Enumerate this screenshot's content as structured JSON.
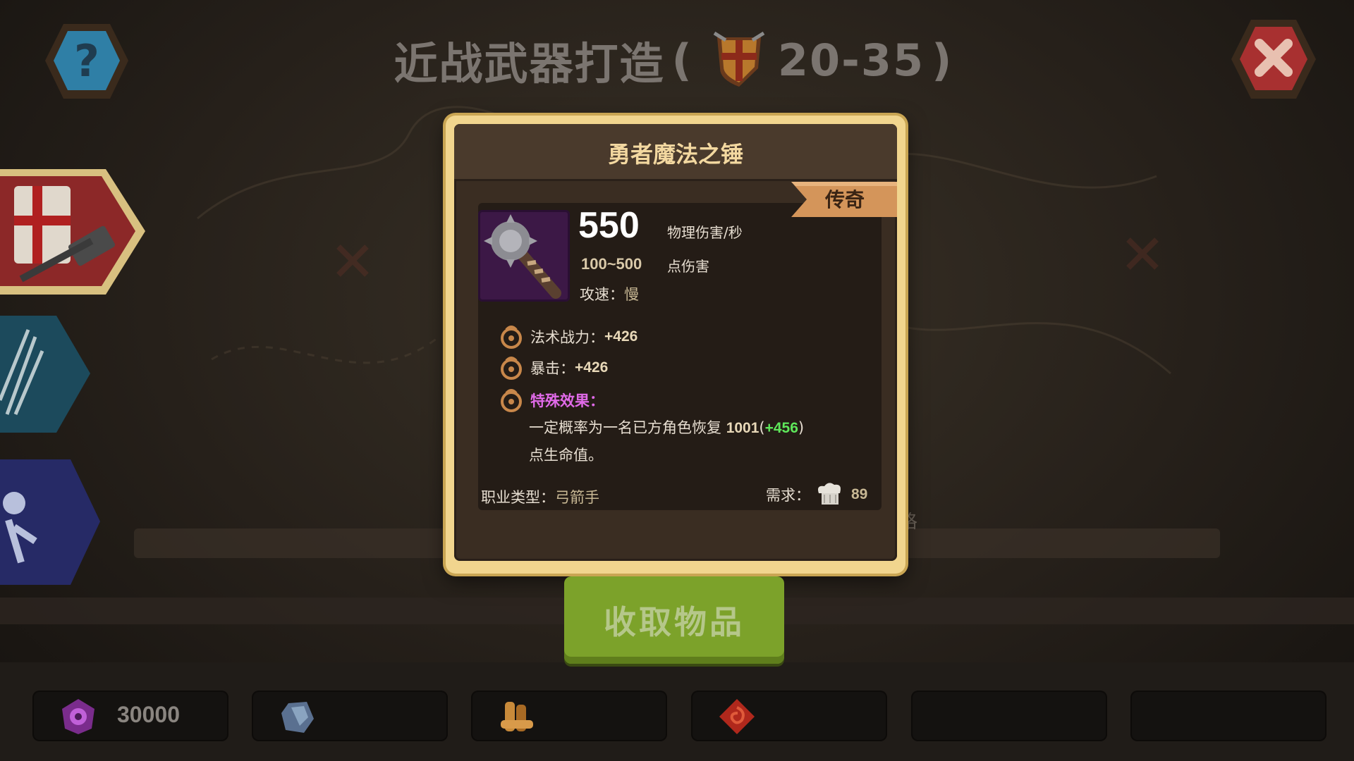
{
  "screen": {
    "title": "近战武器打造",
    "title_paren_open": "(",
    "title_paren_close": ")",
    "level_range": "20-35"
  },
  "background": {
    "partial_label": "格"
  },
  "dialog": {
    "item_name": "勇者魔法之锤",
    "rarity": "传奇",
    "dps_value": "550",
    "dps_label": "物理伤害/秒",
    "damage_range": "100~500",
    "damage_label": "点伤害",
    "speed_label": "攻速：",
    "speed_value": "慢",
    "stats": [
      {
        "label": "法术战力：",
        "value": "+426"
      },
      {
        "label": "暴击：",
        "value": "+426"
      }
    ],
    "special": {
      "label": "特殊效果：",
      "desc_prefix": "一定概率为一名已方角色恢复",
      "base_value": "1001",
      "open_paren": "(",
      "bonus_value": "+456",
      "close_paren": ")",
      "desc_suffix": "点生命值。"
    },
    "class_label": "职业类型：",
    "class_value": "弓箭手",
    "requirement_label": "需求：",
    "requirement_value": "89"
  },
  "collect_button": {
    "label": "收取物品"
  },
  "resources": [
    {
      "icon": "purple-gem-icon",
      "value": "30000"
    },
    {
      "icon": "blue-ore-icon",
      "value": ""
    },
    {
      "icon": "wood-icon",
      "value": ""
    },
    {
      "icon": "red-rune-icon",
      "value": ""
    },
    {
      "icon": "empty-slot",
      "value": ""
    },
    {
      "icon": "empty-slot",
      "value": ""
    }
  ],
  "colors": {
    "frame": "#f1d58e",
    "panel": "#3a2d22",
    "rarity_ribbon": "#d4955a",
    "collect_button": "#7ca22a",
    "special_label": "#e06ae8",
    "bonus": "#5ee65a"
  }
}
